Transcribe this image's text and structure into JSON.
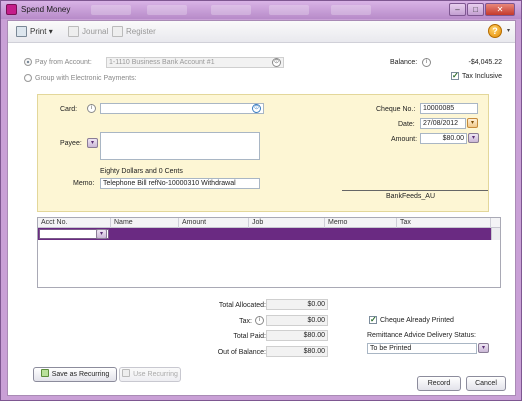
{
  "window": {
    "title": "Spend Money",
    "title_icon": "myob-app-icon",
    "controls": {
      "minimize": "–",
      "maximize": "□",
      "close": "✕"
    },
    "accent": "#6a2a82"
  },
  "toolbar": {
    "print_label": "Print",
    "print_caret": "▾",
    "journal_label": "Journal",
    "register_label": "Register",
    "help_glyph": "?",
    "help_caret": "▾"
  },
  "account": {
    "pay_from_label": "Pay from Account:",
    "pay_from_value": "1-1110 Business Bank Account #1",
    "group_label": "Group with Electronic Payments:",
    "balance_label": "Balance:",
    "balance_value": "-$4,045.22",
    "tax_inclusive_label": "Tax Inclusive",
    "tax_inclusive_checked": true
  },
  "cheque": {
    "card_label": "Card:",
    "card_value": "",
    "payee_label": "Payee:",
    "payee_value": "",
    "amount_words": "Eighty Dollars and 0 Cents",
    "memo_label": "Memo:",
    "memo_value": "Telephone Bill refNo-10000310 Withdrawal",
    "cheque_no_label": "Cheque No.:",
    "cheque_no_value": "10000085",
    "date_label": "Date:",
    "date_value": "27/08/2012",
    "amount_label": "Amount:",
    "amount_value": "$80.00",
    "signature_text": "BankFeeds_AU"
  },
  "grid": {
    "columns": [
      "Acct No.",
      "Name",
      "Amount",
      "Job",
      "Memo",
      "Tax"
    ]
  },
  "totals": {
    "total_allocated_label": "Total Allocated:",
    "total_allocated_value": "$0.00",
    "tax_label": "Tax:",
    "tax_value": "$0.00",
    "total_paid_label": "Total Paid:",
    "total_paid_value": "$80.00",
    "out_of_balance_label": "Out of Balance:",
    "out_of_balance_value": "$80.00"
  },
  "delivery": {
    "cheque_printed_label": "Cheque Already Printed",
    "cheque_printed_checked": true,
    "remittance_label": "Remittance Advice Delivery Status:",
    "remittance_value": "To be Printed"
  },
  "buttons": {
    "save_recurring": "Save as Recurring",
    "use_recurring": "Use Recurring",
    "record": "Record",
    "cancel": "Cancel"
  }
}
